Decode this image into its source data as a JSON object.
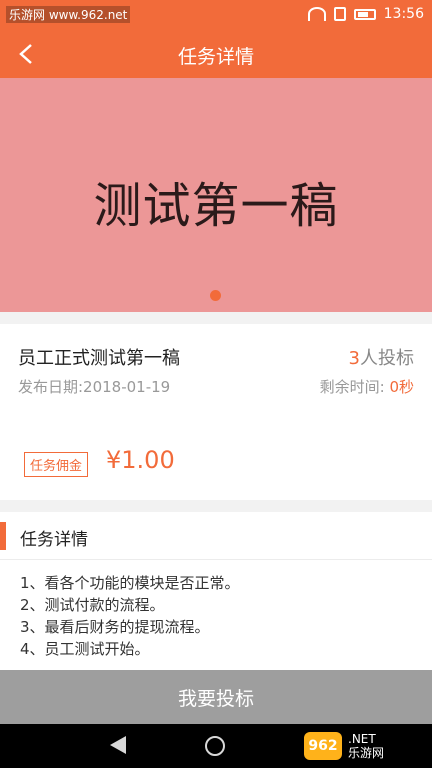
{
  "status_bar": {
    "left_text": "乐游网 www.962.net",
    "time": "13:56"
  },
  "header": {
    "title": "任务详情"
  },
  "banner": {
    "text": "测试第一稿"
  },
  "task": {
    "name": "员工正式测试第一稿",
    "bid_count_num": "3",
    "bid_count_label": "人投标",
    "publish_date": "发布日期:2018-01-19",
    "remaining_label": "剩余时间: ",
    "remaining_value": "0秒",
    "commission_tag": "任务佣金",
    "price": "¥1.00"
  },
  "details": {
    "title": "任务详情",
    "lines": [
      "1、看各个功能的模块是否正常。",
      "2、测试付款的流程。",
      "3、最看后财务的提现流程。",
      "4、员工测试开始。"
    ]
  },
  "action": {
    "bid_button": "我要投标"
  },
  "watermark": {
    "badge": "962",
    "line1": ".NET",
    "line2": "乐游网"
  },
  "colors": {
    "accent": "#f26b3a",
    "banner_bg": "#ec9797",
    "button_bg": "#9e9e9e"
  }
}
